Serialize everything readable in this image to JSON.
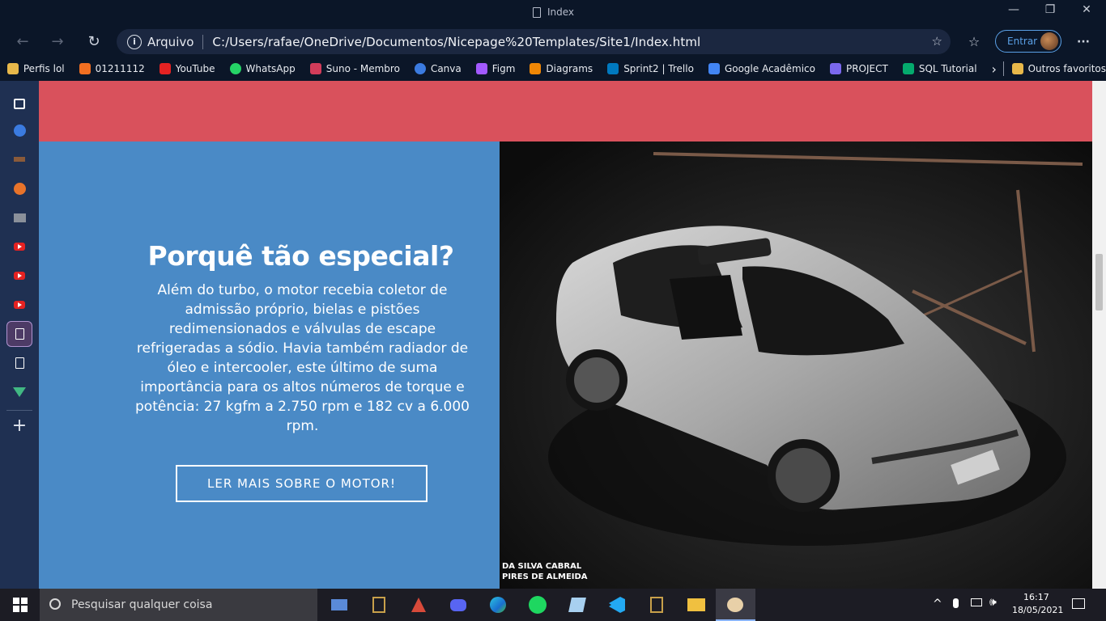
{
  "window": {
    "tab_title": "Index",
    "minimize": "—",
    "restore": "❐",
    "close": "✕"
  },
  "nav": {
    "back": "←",
    "forward": "→",
    "refresh": "↻",
    "info_glyph": "i",
    "scheme_label": "Arquivo",
    "url": "C:/Users/rafae/OneDrive/Documentos/Nicepage%20Templates/Site1/Index.html",
    "favorite_glyph": "☆",
    "collections_glyph": "☆",
    "signin_label": "Entrar",
    "more_glyph": "···"
  },
  "bookmarks": [
    {
      "label": "Perfis lol",
      "color": "#e8b84a"
    },
    {
      "label": "01211112",
      "color": "#f26f21"
    },
    {
      "label": "YouTube",
      "color": "#e52222"
    },
    {
      "label": "WhatsApp",
      "color": "#25d366"
    },
    {
      "label": "Suno - Membro",
      "color": "#d23c5a"
    },
    {
      "label": "Canva",
      "color": "#3b7be0"
    },
    {
      "label": "Figm",
      "color": "#a259ff"
    },
    {
      "label": "Diagrams",
      "color": "#f08705"
    },
    {
      "label": "Sprint2 | Trello",
      "color": "#0079bf"
    },
    {
      "label": "Google Acadêmico",
      "color": "#4285f4"
    },
    {
      "label": "PROJECT",
      "color": "#7b68ee"
    },
    {
      "label": "SQL Tutorial",
      "color": "#04aa6d"
    }
  ],
  "bookmarks_more": "›",
  "bookmarks_other": "Outros favoritos",
  "sidebar": {
    "add_glyph": "+"
  },
  "page": {
    "heading": "Porquê tão especial?",
    "body": "Além do turbo, o motor recebia coletor de admissão próprio, bielas e pistões redimensionados e válvulas de escape refrigeradas a sódio. Havia também radiador de óleo e intercooler, este último de suma importância para os altos números de torque e potência: 27 kgfm a 2.750 rpm e 182 cv a 6.000 rpm.",
    "cta_label": "LER MAIS SOBRE O MOTOR!",
    "photo_credit_line1": "DA SILVA CABRAL",
    "photo_credit_line2": "PIRES DE ALMEIDA",
    "colors": {
      "red_band": "#d9515c",
      "blue_panel": "#4a8ac6"
    }
  },
  "taskbar": {
    "search_placeholder": "Pesquisar qualquer coisa",
    "time": "16:17",
    "date": "18/05/2021"
  }
}
